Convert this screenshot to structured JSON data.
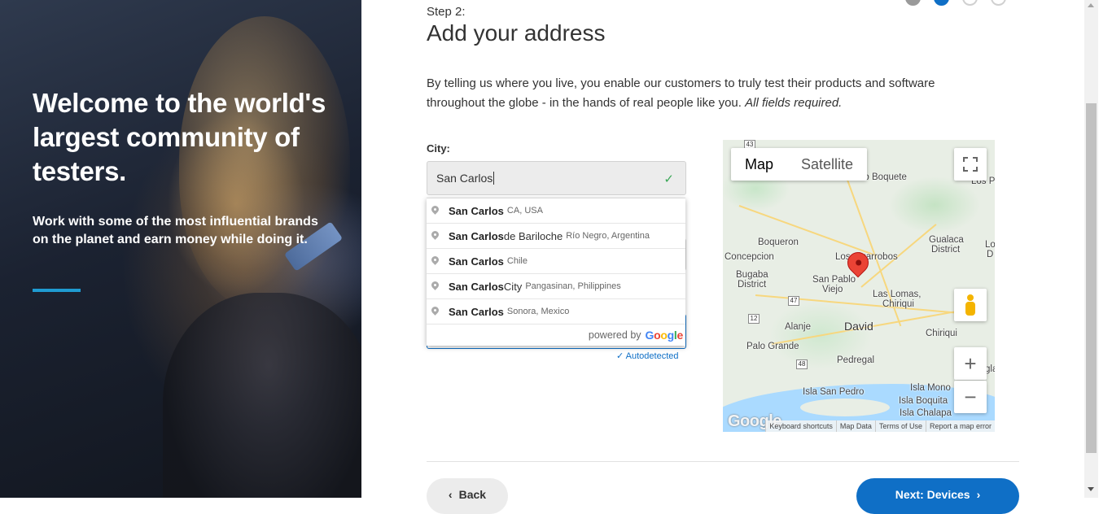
{
  "hero": {
    "headline": "Welcome to the world's largest community of testers.",
    "subtext": "Work with some of the most influential brands on the planet and earn money while doing it."
  },
  "form": {
    "step_label": "Step 2:",
    "title": "Add your address",
    "intro": "By telling us where you live, you enable our customers to truly test their products and software throughout the globe - in the hands of real people like you.",
    "intro_note": "All fields required.",
    "city_label": "City:",
    "city_value": "San Carlos",
    "autodetected": "Autodetected",
    "progress": {
      "total_steps": 4,
      "current_step": 2
    }
  },
  "autocomplete": {
    "suggestions": [
      {
        "match": "San Carlos",
        "rest": "",
        "secondary": "CA, USA"
      },
      {
        "match": "San Carlos",
        "rest": " de Bariloche",
        "secondary": "Río Negro, Argentina"
      },
      {
        "match": "San Carlos",
        "rest": "",
        "secondary": "Chile"
      },
      {
        "match": "San Carlos",
        "rest": " City",
        "secondary": "Pangasinan, Philippines"
      },
      {
        "match": "San Carlos",
        "rest": "",
        "secondary": "Sonora, Mexico"
      }
    ],
    "powered_by": "powered by",
    "google_letters": [
      "G",
      "o",
      "o",
      "g",
      "l",
      "e"
    ]
  },
  "map": {
    "type_map": "Map",
    "type_satellite": "Satellite",
    "zoom_in": "+",
    "zoom_out": "−",
    "logo": "Google",
    "footer": [
      "Keyboard shortcuts",
      "Map Data",
      "Terms of Use",
      "Report a map error"
    ],
    "places": {
      "boquete": "Alto Boquete",
      "lospo": "Los Po",
      "boqueron": "Boqueron",
      "concepcion": "Concepcion",
      "bugaba": "Bugaba",
      "bugaba2": "District",
      "losalgarrobos": "Los Algarrobos",
      "sanpablo": "San Pablo",
      "sanpablo2": "Viejo",
      "laslomas": "Las Lomas,",
      "laslomas2": "Chiriqui",
      "gualaca": "Gualaca",
      "gualaca2": "District",
      "losa": "Los A",
      "losa2": "D",
      "alanje": "Alanje",
      "david": "David",
      "chiriqui": "Chiriqui",
      "paloGrande": "Palo Grande",
      "pedregal": "Pedregal",
      "gla": "gla",
      "islaSanPedro": "Isla San Pedro",
      "islaMono": "Isla Mono",
      "islaBoquita": "Isla Boquita",
      "islaChalapa": "Isla Chalapa"
    },
    "shields": [
      "43",
      "47",
      "12",
      "48"
    ]
  },
  "nav": {
    "back": "Back",
    "next": "Next: Devices"
  },
  "colors": {
    "accent": "#0f6fc6",
    "hero_rule": "#1f9bd1",
    "valid_check": "#3aa757"
  }
}
